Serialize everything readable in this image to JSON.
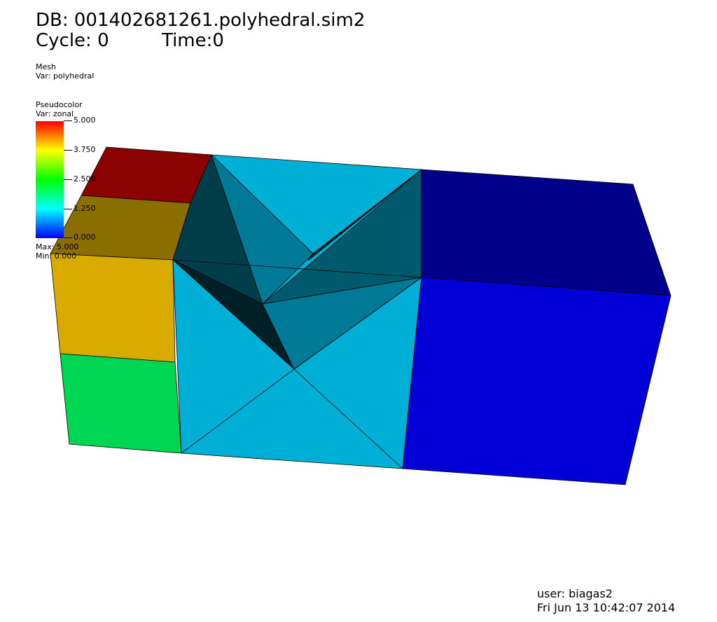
{
  "header": {
    "db_title": "DB: 001402681261.polyhedral.sim2",
    "cycle": "Cycle: 0",
    "time": "Time:0"
  },
  "mesh_legend": {
    "title": "Mesh",
    "var": "Var: polyhedral"
  },
  "pseudocolor_legend": {
    "title": "Pseudocolor",
    "var": "Var: zonal",
    "ticks": [
      "5.000",
      "3.750",
      "2.500",
      "1.250",
      "0.000"
    ],
    "max": "Max: 5.000",
    "min": "Min: 0.000",
    "colors": [
      "#ff0000",
      "#ffff00",
      "#00ff00",
      "#00ffff",
      "#0000ff"
    ]
  },
  "footer": {
    "user": "user: biagas2",
    "date": "Fri Jun 13 10:42:07 2014"
  },
  "zone_colors": {
    "dark_red": "#8b0000",
    "olive": "#8a6e00",
    "gold": "#d9ab00",
    "green": "#00d651",
    "cyan": "#00afd6",
    "navy": "#00008b",
    "blue": "#0000d6",
    "cyan_dark1": "#007a96",
    "cyan_dark2": "#005a6e",
    "cyan_dark3": "#003d4a",
    "cyan_darkest": "#002028"
  }
}
